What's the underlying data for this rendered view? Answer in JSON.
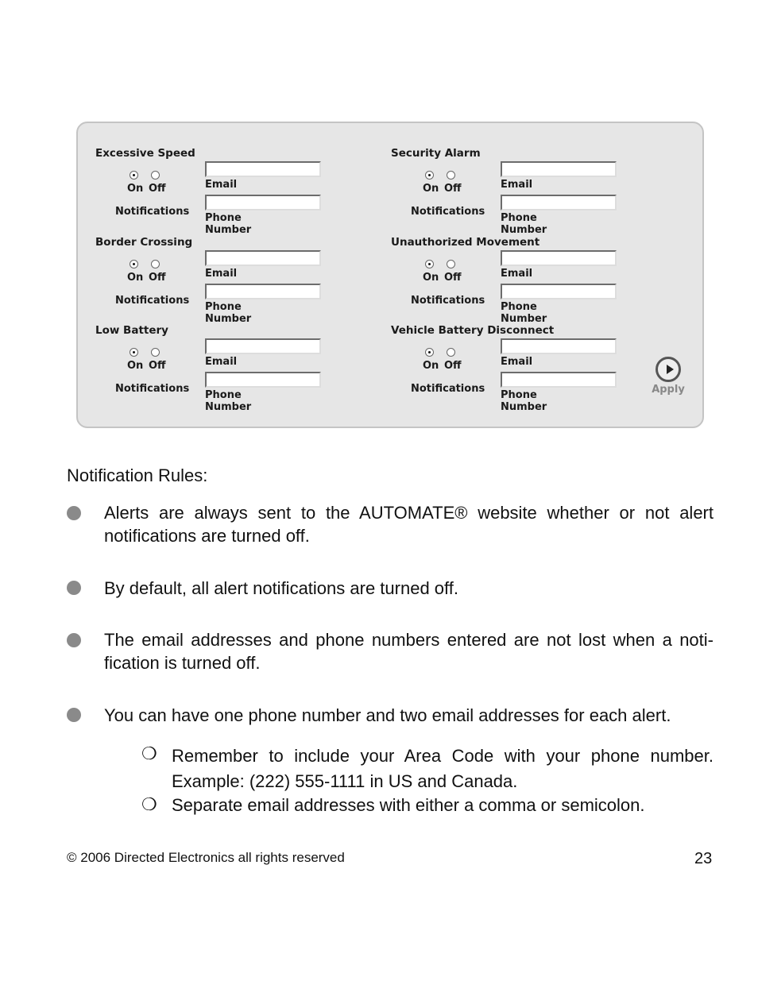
{
  "panel": {
    "groups": [
      {
        "title": "Excessive Speed",
        "on": true
      },
      {
        "title": "Security Alarm",
        "on": true
      },
      {
        "title": "Border Crossing",
        "on": true
      },
      {
        "title": "Unauthorized Movement",
        "on": true
      },
      {
        "title": "Low Battery",
        "on": true
      },
      {
        "title": "Vehicle Battery Disconnect",
        "on": true
      }
    ],
    "on_label": "On",
    "off_label": "Off",
    "notifications_label": "Notifications",
    "email_label": "Email",
    "phone_label": "Phone Number",
    "email_value": "",
    "phone_value": "",
    "apply_label": "Apply"
  },
  "rules": {
    "heading": "Notification Rules:",
    "items": [
      "Alerts are always sent to the AUTOMATE® website whether or not alert notifications are turned off.",
      "By default, all alert notifications are turned off.",
      "The email addresses and phone numbers entered are not lost when a noti-fication is turned off.",
      "You can have one phone number and two email addresses for each alert."
    ],
    "subitems": [
      "Remember to include your Area Code with your phone number. Example: (222) 555-1111 in US and Canada.",
      "Separate email addresses with either a comma or semicolon."
    ]
  },
  "footer": {
    "copyright": "© 2006 Directed Electronics all rights reserved",
    "page": "23"
  }
}
